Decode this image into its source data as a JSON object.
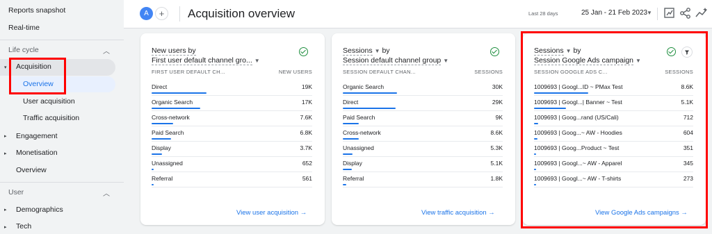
{
  "sidebar": {
    "reports_snapshot": "Reports snapshot",
    "realtime": "Real-time",
    "lifecycle_section": "Life cycle",
    "acquisition": "Acquisition",
    "overview": "Overview",
    "user_acquisition": "User acquisition",
    "traffic_acquisition": "Traffic acquisition",
    "engagement": "Engagement",
    "monetisation": "Monetisation",
    "overview2": "Overview",
    "user_section": "User",
    "demographics": "Demographics",
    "tech": "Tech"
  },
  "header": {
    "avatar_letter": "A",
    "plus": "+",
    "title": "Acquisition overview",
    "date_label": "Last 28 days",
    "date_range": "25 Jan - 21 Feb 2023"
  },
  "cards": [
    {
      "title_line1": "New users by",
      "title_line2": "First user default channel gro...",
      "col_dim": "FIRST USER DEFAULT CH...",
      "col_metric": "NEW USERS",
      "rows": [
        {
          "label": "Direct",
          "value": "19K",
          "pct": 1.0
        },
        {
          "label": "Organic Search",
          "value": "17K",
          "pct": 0.89
        },
        {
          "label": "Cross-network",
          "value": "7.6K",
          "pct": 0.4
        },
        {
          "label": "Paid Search",
          "value": "6.8K",
          "pct": 0.36
        },
        {
          "label": "Display",
          "value": "3.7K",
          "pct": 0.19
        },
        {
          "label": "Unassigned",
          "value": "652",
          "pct": 0.03
        },
        {
          "label": "Referral",
          "value": "561",
          "pct": 0.03
        }
      ],
      "link": "View user acquisition →"
    },
    {
      "title_line1": "Sessions",
      "title_by": "by",
      "title_line2": "Session default channel group",
      "col_dim": "SESSION DEFAULT CHAN...",
      "col_metric": "SESSIONS",
      "rows": [
        {
          "label": "Organic Search",
          "value": "30K",
          "pct": 1.0
        },
        {
          "label": "Direct",
          "value": "29K",
          "pct": 0.97
        },
        {
          "label": "Paid Search",
          "value": "9K",
          "pct": 0.3
        },
        {
          "label": "Cross-network",
          "value": "8.6K",
          "pct": 0.29
        },
        {
          "label": "Unassigned",
          "value": "5.3K",
          "pct": 0.18
        },
        {
          "label": "Display",
          "value": "5.1K",
          "pct": 0.17
        },
        {
          "label": "Referral",
          "value": "1.8K",
          "pct": 0.06
        }
      ],
      "link": "View traffic acquisition →"
    },
    {
      "title_line1": "Sessions",
      "title_by": "by",
      "title_line2": "Session Google Ads campaign",
      "col_dim": "SESSION GOOGLE ADS C...",
      "col_metric": "SESSIONS",
      "rows": [
        {
          "label": "1009693 | Googl...ID ~ PMax Test",
          "value": "8.6K",
          "pct": 1.0
        },
        {
          "label": "1009693 | Googl...| Banner ~ Test",
          "value": "5.1K",
          "pct": 0.59
        },
        {
          "label": "1009693 | Goog...rand (US/Cali)",
          "value": "712",
          "pct": 0.08
        },
        {
          "label": "1009693 | Goog...~ AW - Hoodies",
          "value": "604",
          "pct": 0.07
        },
        {
          "label": "1009693 | Goog...Product ~ Test",
          "value": "351",
          "pct": 0.04
        },
        {
          "label": "1009693 | Googl...~ AW - Apparel",
          "value": "345",
          "pct": 0.04
        },
        {
          "label": "1009693 | Googl...~ AW - T-shirts",
          "value": "273",
          "pct": 0.03
        }
      ],
      "link": "View Google Ads campaigns →"
    }
  ],
  "colors": {
    "accent": "#1a73e8",
    "highlight": "#ff0000",
    "check": "#1e8e3e"
  }
}
